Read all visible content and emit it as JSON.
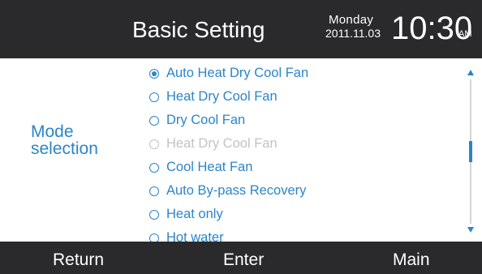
{
  "header": {
    "title": "Basic Setting",
    "day": "Monday",
    "date": "2011.11.03",
    "time": "10:30",
    "ampm": "AM"
  },
  "side_label": "Mode\nselection",
  "mode_options": [
    {
      "label": "Auto Heat Dry Cool Fan",
      "selected": true,
      "enabled": true
    },
    {
      "label": "Heat Dry Cool Fan",
      "selected": false,
      "enabled": true
    },
    {
      "label": "Dry Cool Fan",
      "selected": false,
      "enabled": true
    },
    {
      "label": "Heat Dry Cool Fan",
      "selected": false,
      "enabled": false
    },
    {
      "label": "Cool Heat Fan",
      "selected": false,
      "enabled": true
    },
    {
      "label": "Auto By-pass Recovery",
      "selected": false,
      "enabled": true
    },
    {
      "label": "Heat only",
      "selected": false,
      "enabled": true
    },
    {
      "label": "Hot water",
      "selected": false,
      "enabled": true
    }
  ],
  "footer": {
    "return_label": "Return",
    "enter_label": "Enter",
    "main_label": "Main"
  },
  "colors": {
    "bar_background": "#2a2a2c",
    "accent": "#2b85c8",
    "disabled_text": "#c3c3c3",
    "scroll_track": "#d4d4d4"
  },
  "icons": {
    "scroll_up": "triangle-up-icon",
    "scroll_down": "triangle-down-icon",
    "radio_selected": "radio-checked-icon",
    "radio_unselected": "radio-unchecked-icon"
  }
}
